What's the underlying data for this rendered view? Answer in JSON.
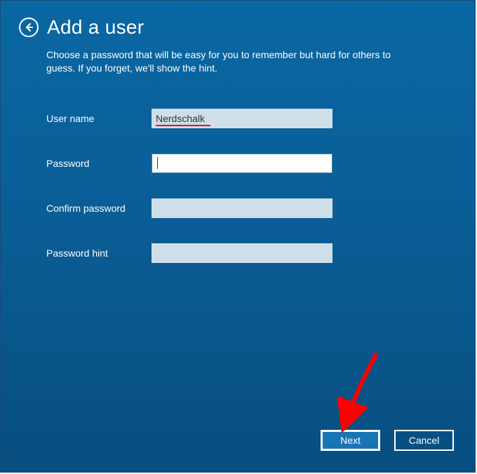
{
  "header": {
    "title": "Add a user",
    "subtitle": "Choose a password that will be easy for you to remember but hard for others to guess. If you forget, we'll show the hint."
  },
  "form": {
    "username_label": "User name",
    "username_value": "Nerdschalk",
    "password_label": "Password",
    "password_value": "",
    "confirm_label": "Confirm password",
    "confirm_value": "",
    "hint_label": "Password hint",
    "hint_value": ""
  },
  "buttons": {
    "next": "Next",
    "cancel": "Cancel"
  },
  "annotations": {
    "username_underline_color": "#ff0000",
    "arrow_color": "#ff0000"
  }
}
